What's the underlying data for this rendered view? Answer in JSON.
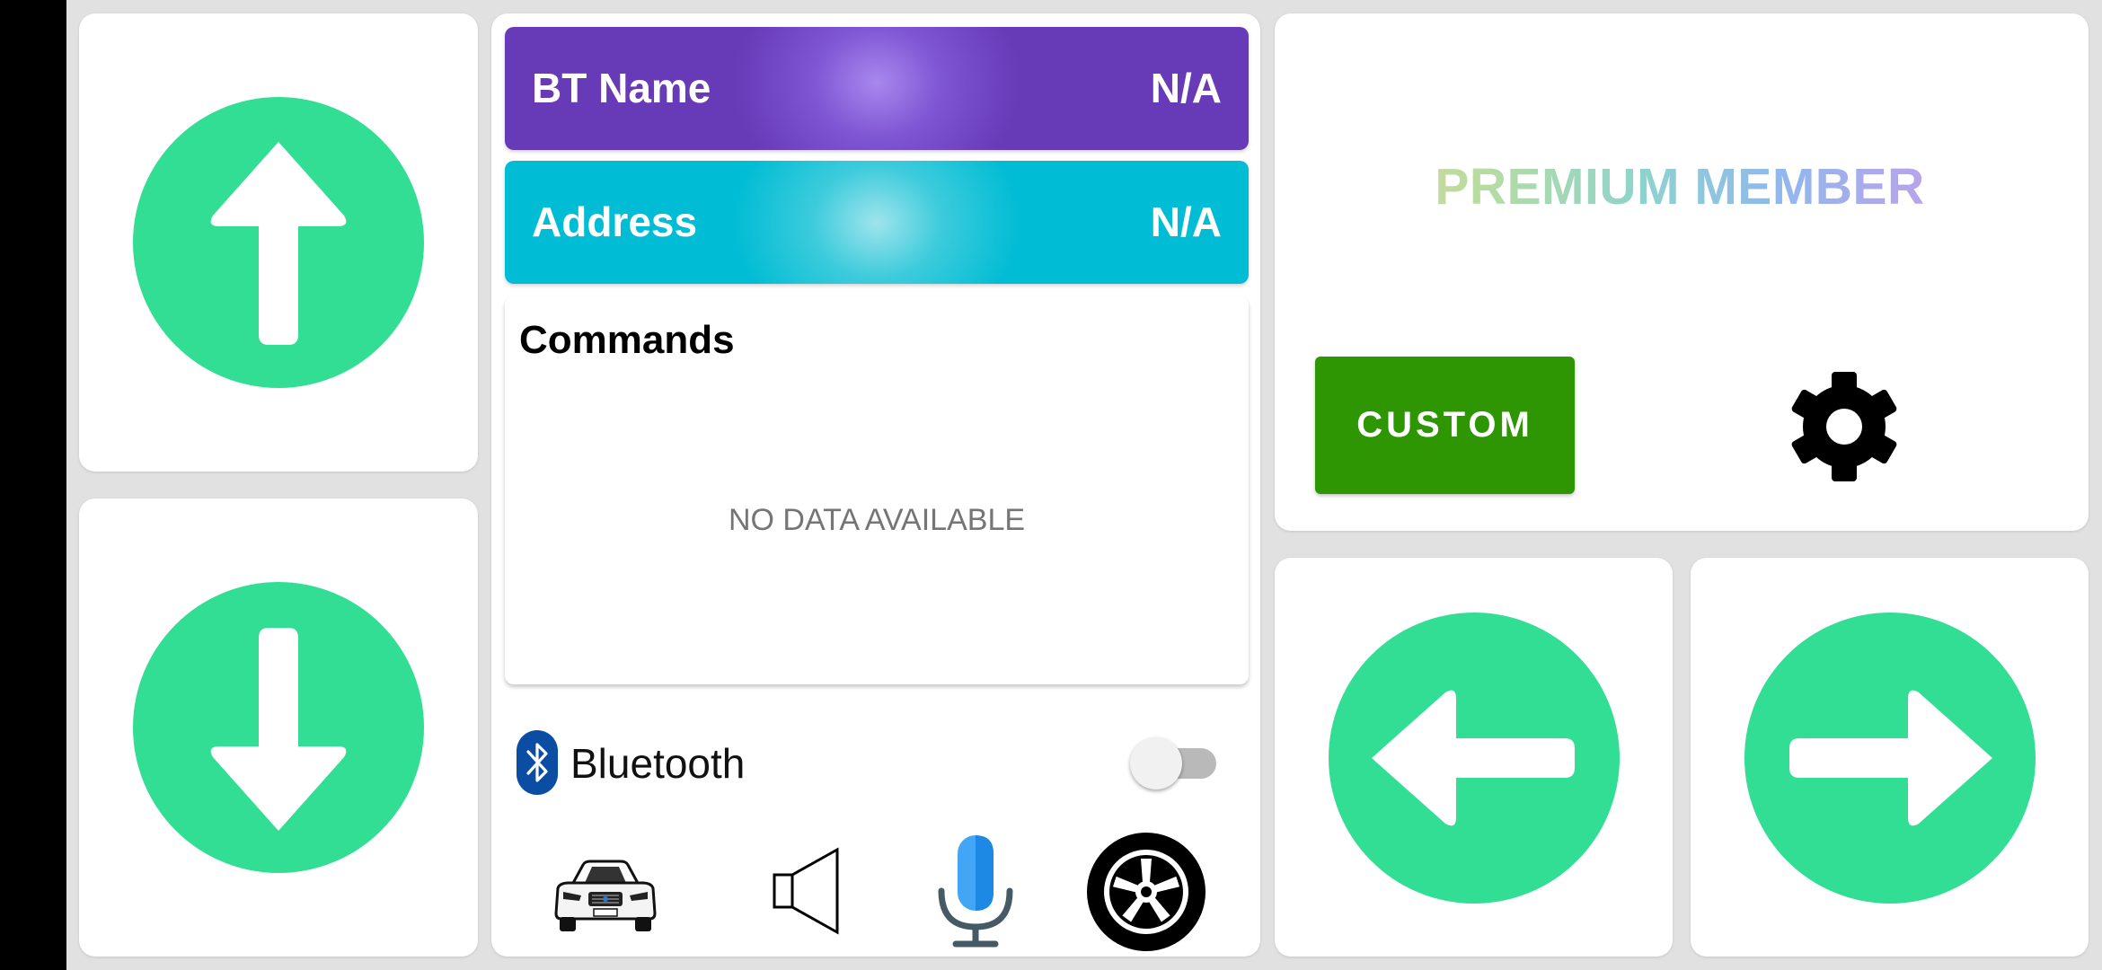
{
  "device": {
    "bt_name_label": "BT Name",
    "bt_name_value": "N/A",
    "address_label": "Address",
    "address_value": "N/A"
  },
  "commands": {
    "title": "Commands",
    "empty_text": "NO DATA AVAILABLE"
  },
  "bluetooth": {
    "label": "Bluetooth",
    "enabled": false,
    "icon": "bluetooth-icon"
  },
  "bottom_icons": [
    "car-icon",
    "speaker-icon",
    "microphone-icon",
    "wheel-icon"
  ],
  "premium": {
    "label": "PREMIUM MEMBER"
  },
  "custom_button": {
    "label": "CUSTOM",
    "color": "#2e9603"
  },
  "direction_buttons": [
    "arrow-up-icon",
    "arrow-down-icon",
    "arrow-left-icon",
    "arrow-right-icon"
  ],
  "colors": {
    "direction_button": "#31de93",
    "bt_name_bar": "#673ab7",
    "address_bar": "#00bcd4",
    "bluetooth_icon": "#0a4da2"
  }
}
